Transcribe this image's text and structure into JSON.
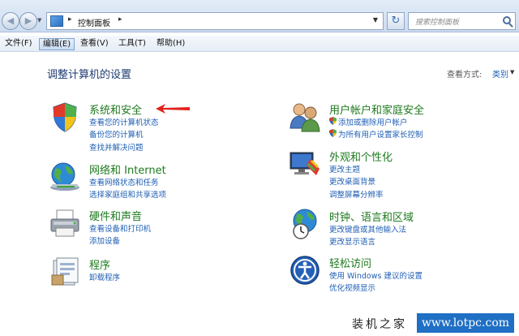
{
  "address_bar": {
    "sep1": "▸",
    "path": "控制面板",
    "sep2": "▸",
    "refresh_glyph": "↻",
    "search_placeholder": "搜索控制面板"
  },
  "menu": {
    "items": [
      {
        "label": "文件(F)"
      },
      {
        "label": "编辑(E)"
      },
      {
        "label": "查看(V)"
      },
      {
        "label": "工具(T)"
      },
      {
        "label": "帮助(H)"
      }
    ],
    "active_index": 1
  },
  "page": {
    "title": "调整计算机的设置",
    "view_label": "查看方式:",
    "view_value": "类别"
  },
  "categories_left": [
    {
      "title": "系统和安全",
      "links": [
        "查看您的计算机状态",
        "备份您的计算机",
        "查找并解决问题"
      ]
    },
    {
      "title": "网络和 Internet",
      "links": [
        "查看网络状态和任务",
        "选择家庭组和共享选项"
      ]
    },
    {
      "title": "硬件和声音",
      "links": [
        "查看设备和打印机",
        "添加设备"
      ]
    },
    {
      "title": "程序",
      "links": [
        "卸载程序"
      ]
    }
  ],
  "categories_right": [
    {
      "title": "用户帐户和家庭安全",
      "links": [
        "添加或删除用户帐户",
        "为所有用户设置家长控制"
      ]
    },
    {
      "title": "外观和个性化",
      "links": [
        "更改主题",
        "更改桌面背景",
        "调整屏幕分辨率"
      ]
    },
    {
      "title": "时钟、语言和区域",
      "links": [
        "更改键盘或其他输入法",
        "更改显示语言"
      ]
    },
    {
      "title": "轻松访问",
      "links": [
        "使用 Windows 建议的设置",
        "优化视频显示"
      ]
    }
  ],
  "watermark": {
    "site_name": "装机之家",
    "site_url": "www.lotpc.com"
  },
  "colors": {
    "category_title": "#1e7a1e",
    "link": "#1f5fb4",
    "page_title": "#1e3b70",
    "arrow": "#e0231b"
  },
  "icons": [
    "back-icon",
    "forward-icon",
    "control-panel-icon",
    "refresh-icon",
    "search-icon",
    "security-shield-icon",
    "network-globe-icon",
    "printer-icon",
    "programs-icon",
    "users-icon",
    "display-paint-icon",
    "clock-globe-icon",
    "ease-of-access-icon",
    "uac-shield-icon",
    "red-arrow-icon"
  ]
}
